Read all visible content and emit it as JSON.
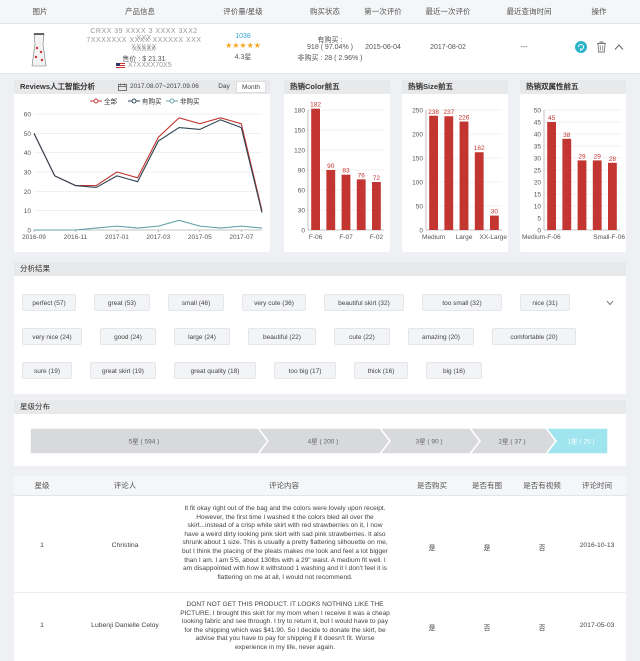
{
  "table_header": {
    "image": "图片",
    "product_info": "产品信息",
    "rating": "评价量/星级",
    "buy_status": "购买状态",
    "first_review": "第一次评价",
    "last_review": "最近一次评价",
    "last_query": "最近查询时间",
    "action": "操作"
  },
  "product": {
    "line1": "CRXX 39 XXXX 3 XXXX 3XX2 XXX",
    "line2": "7XXXXXXX XXXX XXXXXX XXX XXXXX",
    "line3": "XXXXX",
    "price": "售价 : $ 21.31",
    "asin": "X7XXXX70X5",
    "review_count": "1038",
    "stars": "★★★★★",
    "star_rating": "4.3星",
    "buy_label": "有购买 :",
    "buy_yes": "918 ( 97.04% )",
    "buy_no": "非购买 : 28 ( 2.96% )",
    "first_review_date": "2015-06-04",
    "last_review_date": "2017-08-02",
    "last_query": "---"
  },
  "reviews_panel": {
    "title": "Reviews人工智能分析",
    "date_range": "2017.08.07~2017.09.06",
    "day_btn": "Day",
    "month_btn": "Month"
  },
  "color_panel": {
    "title": "热销Color前五"
  },
  "size_panel": {
    "title": "热销Size前五"
  },
  "dual_panel": {
    "title": "热销双属性前五"
  },
  "analysis": {
    "title": "分析结果",
    "tags": [
      "perfect (57)",
      "great (53)",
      "small (46)",
      "very cute (36)",
      "beautiful skirt (32)",
      "too small (32)",
      "nice (31)",
      "very nice (24)",
      "good (24)",
      "large (24)",
      "beautiful (22)",
      "cute (22)",
      "amazing (20)",
      "comfortable (20)",
      "sure (19)",
      "great skirt (19)",
      "great quality (18)",
      "too big (17)",
      "thick (16)",
      "big (16)"
    ]
  },
  "stars_dist": {
    "title": "星级分布",
    "segments": [
      "5星 ( 594 )",
      "4星 ( 200 )",
      "3星 ( 90 )",
      "2星 ( 37 )",
      "1星 ( 25 )"
    ]
  },
  "reviews_table": {
    "headers": [
      "星级",
      "评论人",
      "评论内容",
      "是否购买",
      "是否有图",
      "是否有视频",
      "评论时间"
    ],
    "rows": [
      {
        "star": "1",
        "reviewer": "Christina",
        "content": "It fit okay right out of the bag and the colors were lovely upon receipt. However, the first time I washed it the colors bled all over the skirt...instead of a crisp white skirt with red strawberries on it, I now have a weird dirty looking pink skirt with sad pink strawberries. It also shrunk about 1 size. This is usually a pretty flattering silhouette on me, but I think the placing of the pleats makes me look and feel a lot bigger than I am. I am 5'5, about 130lbs with a 29\" waist. A medium fit well. I am disappointed with how it withstood 1 washing and it I don't feel it is flattering on me at all, I would not recommend.",
        "bought": "是",
        "has_image": "是",
        "has_video": "否",
        "date": "2016-10-13"
      },
      {
        "star": "1",
        "reviewer": "Lubenji Danielle Celoy",
        "content": "DONT NOT GET THIS PRODUCT. IT LOOKS NOTHING LIKE THE PICTURE. I brought this skirt for my mom when I receive it was a cheap looking fabric and see through. I try to return it, but I would have to pay for the shipping which was $41.90. So I decide to donate the skirt, be advise that you have to pay for shipping if it doesn't fit. Worse experience in my life, never again.",
        "bought": "是",
        "has_image": "否",
        "has_video": "否",
        "date": "2017-05-03"
      }
    ]
  },
  "chart_data": [
    {
      "type": "line",
      "legend": [
        "全部",
        "有购买",
        "非购买"
      ],
      "x": [
        "2016-09",
        "2016-10",
        "2016-11",
        "2016-12",
        "2017-01",
        "2017-02",
        "2017-03",
        "2017-04",
        "2017-05",
        "2017-06",
        "2017-07",
        "2017-08"
      ],
      "x_tick_labels": [
        "2016-09",
        "2016-11",
        "2017-01",
        "2017-03",
        "2017-05",
        "2017-07"
      ],
      "series": [
        {
          "name": "全部",
          "color": "#c23531",
          "values": [
            50,
            28,
            23,
            23,
            30,
            27,
            48,
            58,
            55,
            58,
            55,
            10
          ]
        },
        {
          "name": "有购买",
          "color": "#2f4554",
          "values": [
            50,
            28,
            23,
            22,
            28,
            25,
            46,
            53,
            52,
            57,
            53,
            9
          ]
        },
        {
          "name": "非购买",
          "color": "#61a0a8",
          "values": [
            0,
            0,
            0,
            1,
            2,
            1,
            2,
            5,
            2,
            1,
            2,
            1
          ]
        }
      ],
      "ylim": [
        0,
        60
      ],
      "yticks": [
        0,
        10,
        20,
        30,
        40,
        50,
        60
      ],
      "grid": true,
      "legend_position": "top"
    },
    {
      "type": "bar",
      "categories": [
        "F-06",
        "",
        "F-07",
        "",
        "F-02"
      ],
      "values": [
        182,
        90,
        83,
        76,
        72
      ],
      "ylim": [
        0,
        180
      ],
      "yticks": [
        0,
        30,
        60,
        90,
        120,
        150,
        180
      ],
      "color": "#c23531"
    },
    {
      "type": "bar",
      "categories": [
        "Medium",
        "",
        "Large",
        "",
        "XX-Large"
      ],
      "values": [
        238,
        237,
        226,
        162,
        30
      ],
      "ylim": [
        0,
        250
      ],
      "yticks": [
        0,
        50,
        100,
        150,
        200,
        250
      ],
      "color": "#c23531"
    },
    {
      "type": "bar",
      "categories": [
        "Medium-F-06",
        "",
        "",
        "",
        "Small-F-06"
      ],
      "values": [
        45,
        38,
        29,
        29,
        28
      ],
      "ylim": [
        0,
        50
      ],
      "yticks": [
        0,
        5,
        10,
        15,
        20,
        25,
        30,
        35,
        40,
        45,
        50
      ],
      "color": "#c23531"
    }
  ]
}
